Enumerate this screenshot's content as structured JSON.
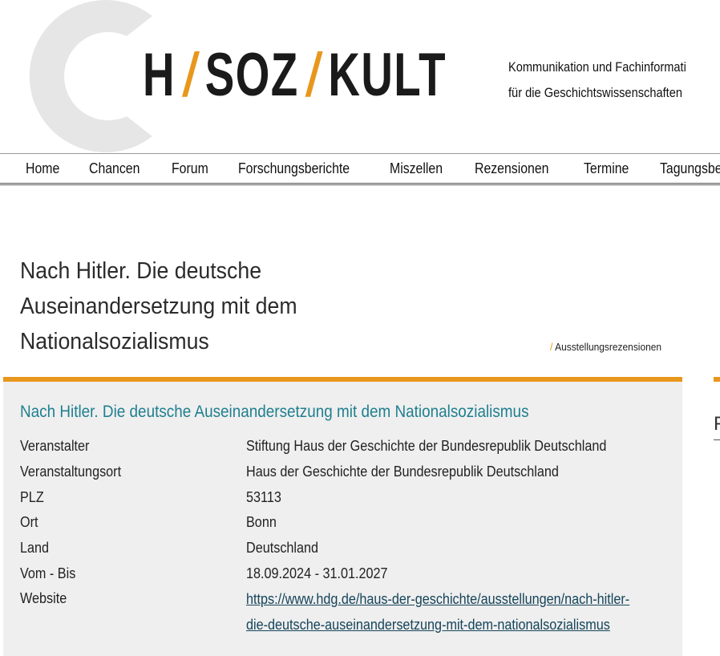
{
  "header": {
    "logo": {
      "part1": "H",
      "part2": "SOZ",
      "part3": "KULT",
      "slash": "/"
    },
    "tagline_line1": "Kommunikation und Fachinformati",
    "tagline_line2": "für die Geschichtswissenschaften"
  },
  "nav": {
    "items": [
      "Home",
      "Chancen",
      "Forum",
      "Forschungsberichte",
      "Miszellen",
      "Rezensionen",
      "Termine",
      "Tagungsberichte"
    ]
  },
  "page": {
    "title_line1": "Nach Hitler. Die deutsche",
    "title_line2": "Auseinandersetzung mit dem",
    "title_line3": "Nationalsozialismus",
    "breadcrumb_sep": "/",
    "breadcrumb": "Ausstellungsrezensionen"
  },
  "info": {
    "title": "Nach Hitler. Die deutsche Auseinandersetzung mit dem Nationalsozialismus",
    "rows": [
      {
        "key": "Veranstalter",
        "value": "Stiftung Haus der Geschichte der Bundesrepublik Deutschland"
      },
      {
        "key": "Veranstaltungsort",
        "value": "Haus der Geschichte der Bundesrepublik Deutschland"
      },
      {
        "key": "PLZ",
        "value": "53113"
      },
      {
        "key": "Ort",
        "value": "Bonn"
      },
      {
        "key": "Land",
        "value": "Deutschland"
      },
      {
        "key": "Vom - Bis",
        "value": "18.09.2024 - 31.01.2027"
      }
    ],
    "website_label": "Website",
    "website_line1": "https://www.hdg.de/haus-der-geschichte/ausstellungen/nach-hitler-",
    "website_line2": "die-deutsche-auseinandersetzung-mit-dem-nationalsozialismus"
  },
  "sidebar": {
    "fragment": "F"
  },
  "colors": {
    "accent": "#e8971d",
    "title_teal": "#1f7f8f",
    "link": "#15445a",
    "box_bg": "#efefef"
  }
}
